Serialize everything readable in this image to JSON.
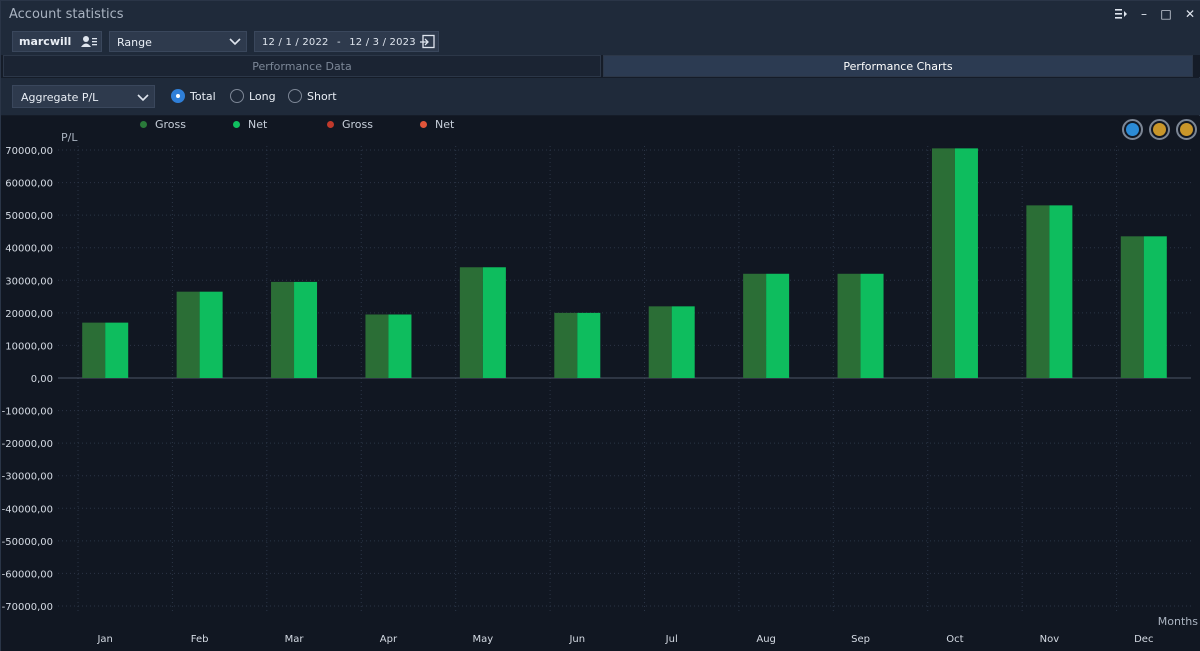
{
  "window": {
    "title": "Account statistics",
    "controls": {
      "menu_icon": "menu-pin-icon",
      "minimize": "–",
      "maximize": "□",
      "close": "✕"
    }
  },
  "toolbar": {
    "account": "marcwill",
    "range_select": "Range",
    "date_from": {
      "month": "12",
      "day": "1",
      "year": "2022"
    },
    "date_to": {
      "month": "12",
      "day": "3",
      "year": "2023"
    },
    "date_separator": "-"
  },
  "tabs": [
    {
      "label": "Performance Data",
      "active": false
    },
    {
      "label": "Performance Charts",
      "active": true
    }
  ],
  "options": {
    "metric_select": "Aggregate P/L",
    "radios": [
      {
        "label": "Total",
        "checked": true
      },
      {
        "label": "Long",
        "checked": false
      },
      {
        "label": "Short",
        "checked": false
      }
    ]
  },
  "legend": [
    {
      "label": "Gross",
      "color": "#2a7a3a"
    },
    {
      "label": "Net",
      "color": "#10c060"
    },
    {
      "label": "Gross",
      "color": "#c0392b"
    },
    {
      "label": "Net",
      "color": "#e2553a"
    }
  ],
  "colors": {
    "gross_bar": "#2b6e36",
    "net_bar": "#0ebd5e",
    "accent_blue": "#2f7fd8",
    "btn_blue": "#2c8bd6",
    "btn_gold": "#c9962a"
  },
  "chart_data": {
    "type": "bar",
    "ylabel": "P/L",
    "xlabel": "Months",
    "ylim": [
      -70000,
      70000
    ],
    "yticks": [
      70000,
      60000,
      50000,
      40000,
      30000,
      20000,
      10000,
      0,
      -10000,
      -20000,
      -30000,
      -40000,
      -50000,
      -60000,
      -70000
    ],
    "ytick_labels": [
      "70000,00",
      "60000,00",
      "50000,00",
      "40000,00",
      "30000,00",
      "20000,00",
      "10000,00",
      "0,00",
      "-10000,00",
      "-20000,00",
      "-30000,00",
      "-40000,00",
      "-50000,00",
      "-60000,00",
      "-70000,00"
    ],
    "categories": [
      "Jan",
      "Feb",
      "Mar",
      "Apr",
      "May",
      "Jun",
      "Jul",
      "Aug",
      "Sep",
      "Oct",
      "Nov",
      "Dec"
    ],
    "series": [
      {
        "name": "Gross",
        "values": [
          17000,
          26500,
          29500,
          19500,
          34000,
          20000,
          22000,
          32000,
          32000,
          70500,
          53000,
          43500
        ]
      },
      {
        "name": "Net",
        "values": [
          17000,
          26500,
          29500,
          19500,
          34000,
          20000,
          22000,
          32000,
          32000,
          70500,
          53000,
          43500
        ]
      }
    ],
    "grid": true
  }
}
